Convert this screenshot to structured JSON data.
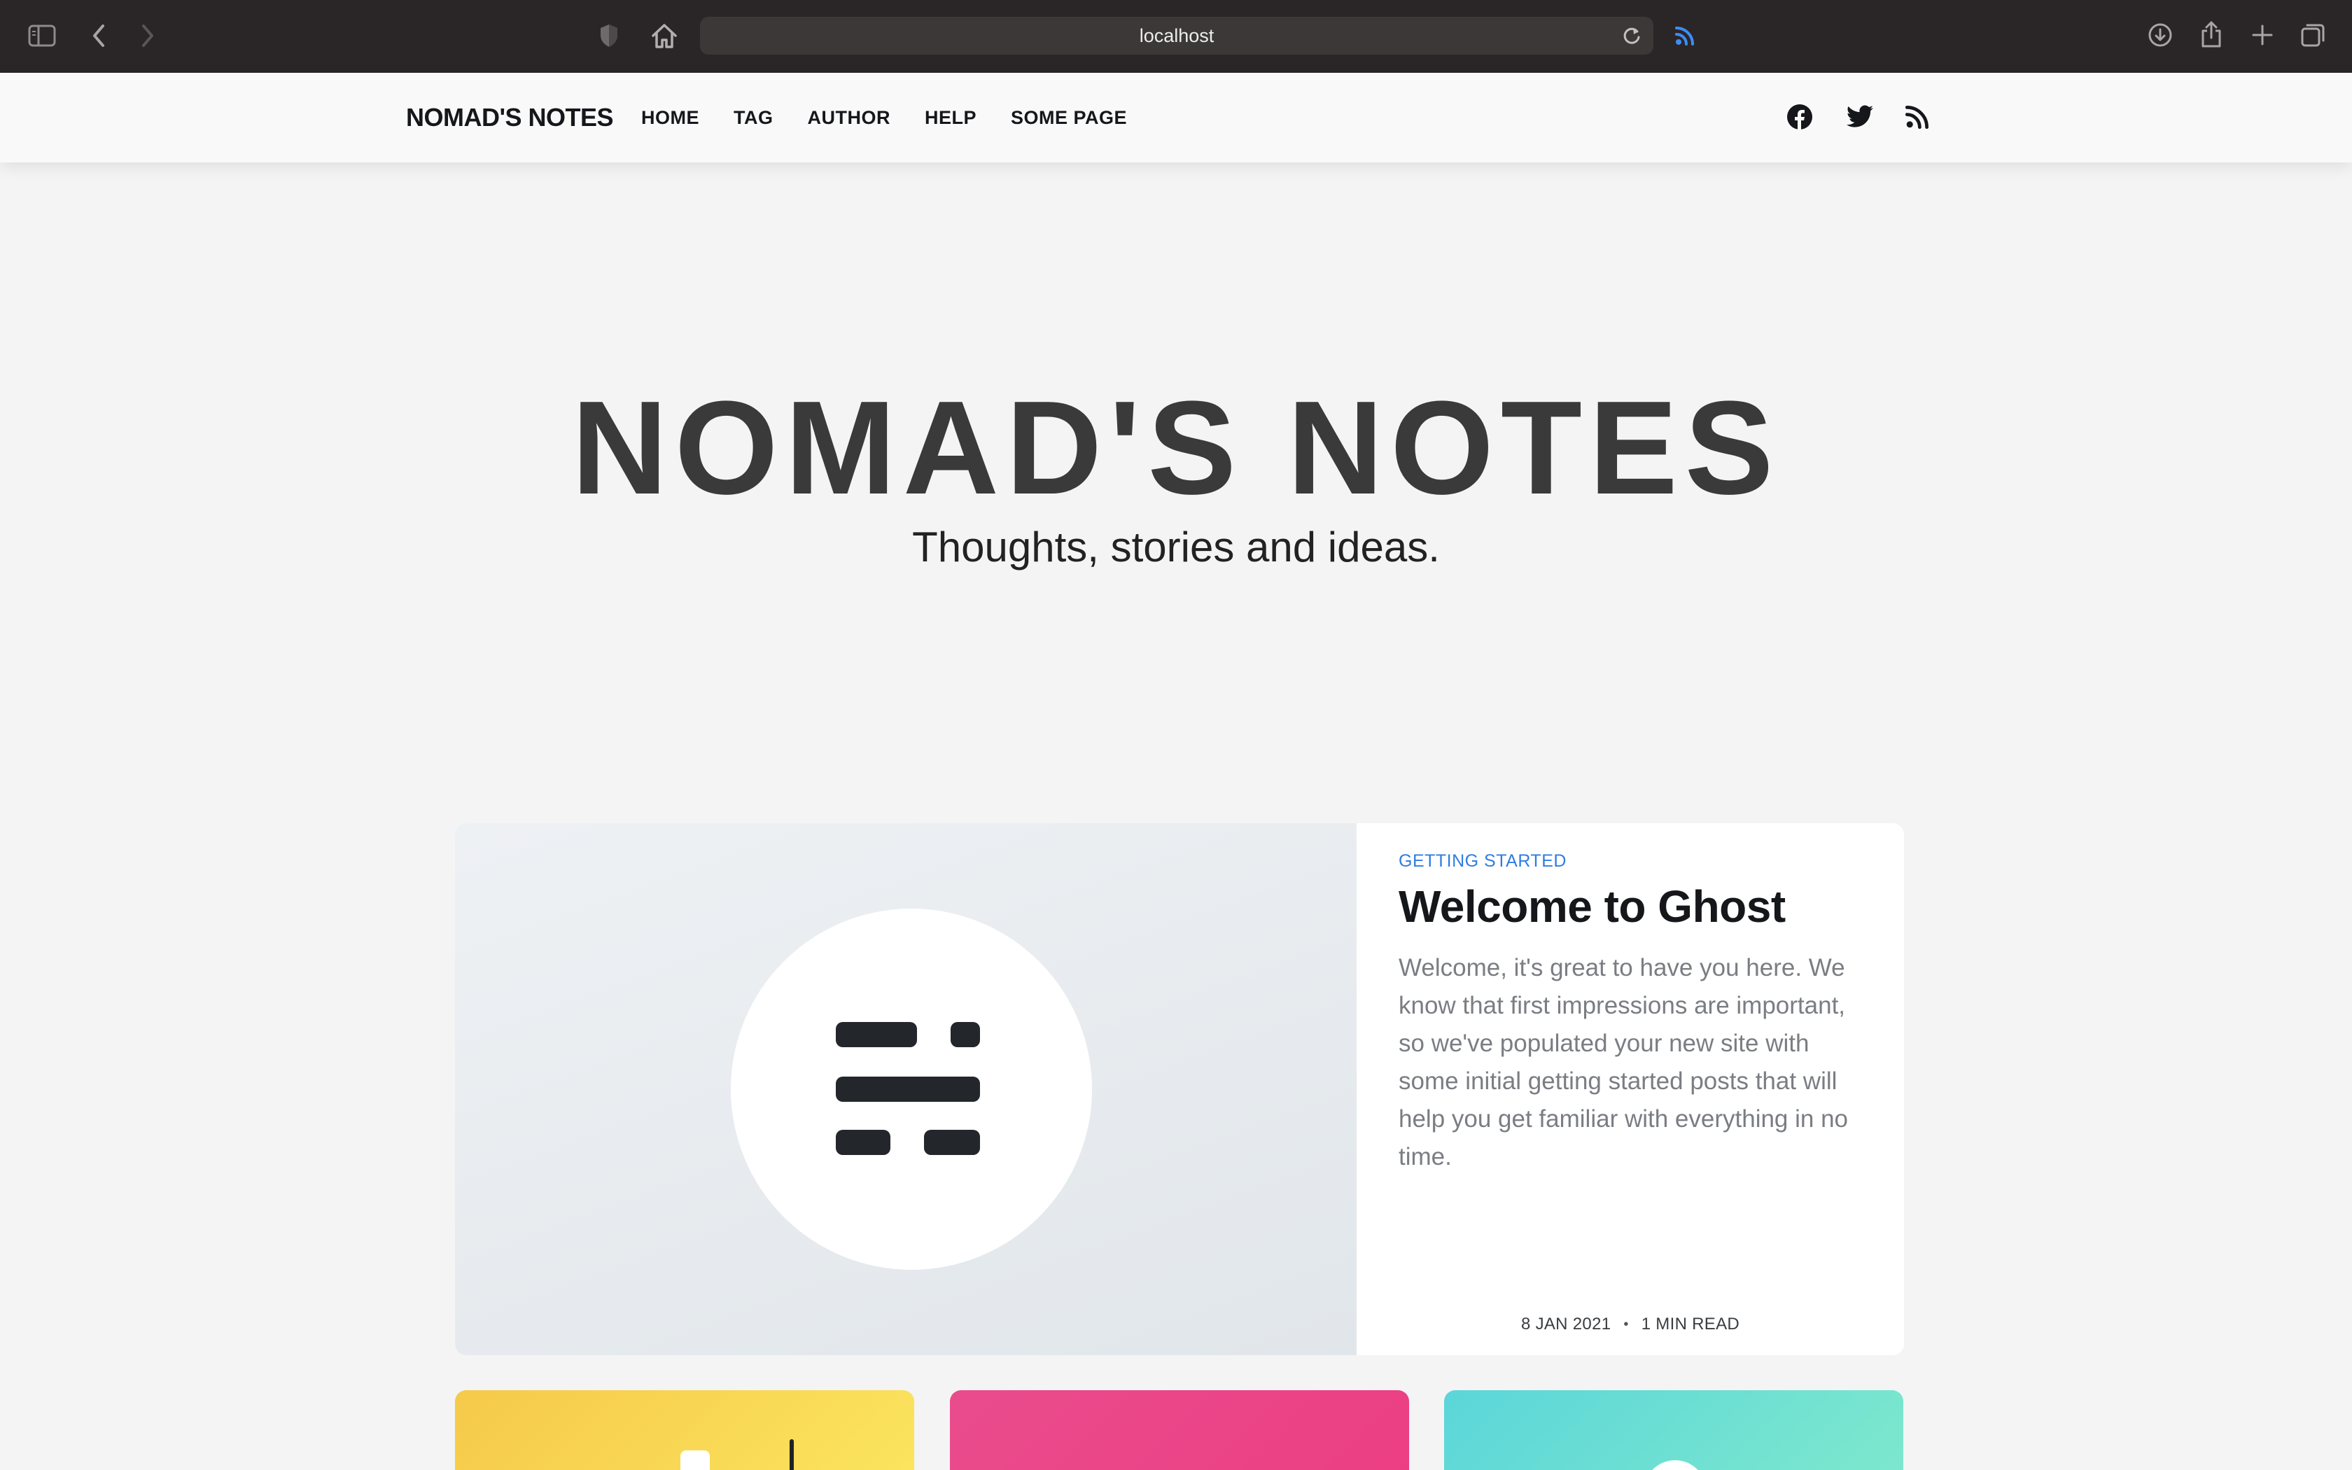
{
  "browser": {
    "url": "localhost",
    "icons": [
      "sidebar-icon",
      "back-icon",
      "forward-icon",
      "shield-icon",
      "home-icon",
      "reload-icon",
      "rss-icon",
      "download-icon",
      "share-icon",
      "new-tab-icon",
      "tabs-overview-icon"
    ]
  },
  "header": {
    "logo": "NOMAD'S NOTES",
    "nav": [
      "HOME",
      "TAG",
      "AUTHOR",
      "HELP",
      "SOME PAGE"
    ],
    "social_icons": [
      "facebook-icon",
      "twitter-icon",
      "rss-icon"
    ]
  },
  "hero": {
    "title": "NOMAD'S NOTES",
    "subtitle": "Thoughts, stories and ideas."
  },
  "featured_post": {
    "tag": "GETTING STARTED",
    "title": "Welcome to Ghost",
    "excerpt": "Welcome, it's great to have you here. We know that first impressions are important, so we've populated your new site with some initial getting started posts that will help you get familiar with everything in no time.",
    "date": "8 JAN 2021",
    "separator": "•",
    "reading_time": "1 MIN READ",
    "image_icon": "ghost-logo-icon"
  },
  "post_cards": [
    {
      "color": "#f8d44f"
    },
    {
      "color": "#ea4589"
    },
    {
      "color": "#6de0d3"
    }
  ],
  "colors": {
    "browser_chrome": "#2a2627",
    "page_bg": "#f4f4f4",
    "tag_accent": "#2f7de1",
    "text_dark": "#15171a"
  }
}
